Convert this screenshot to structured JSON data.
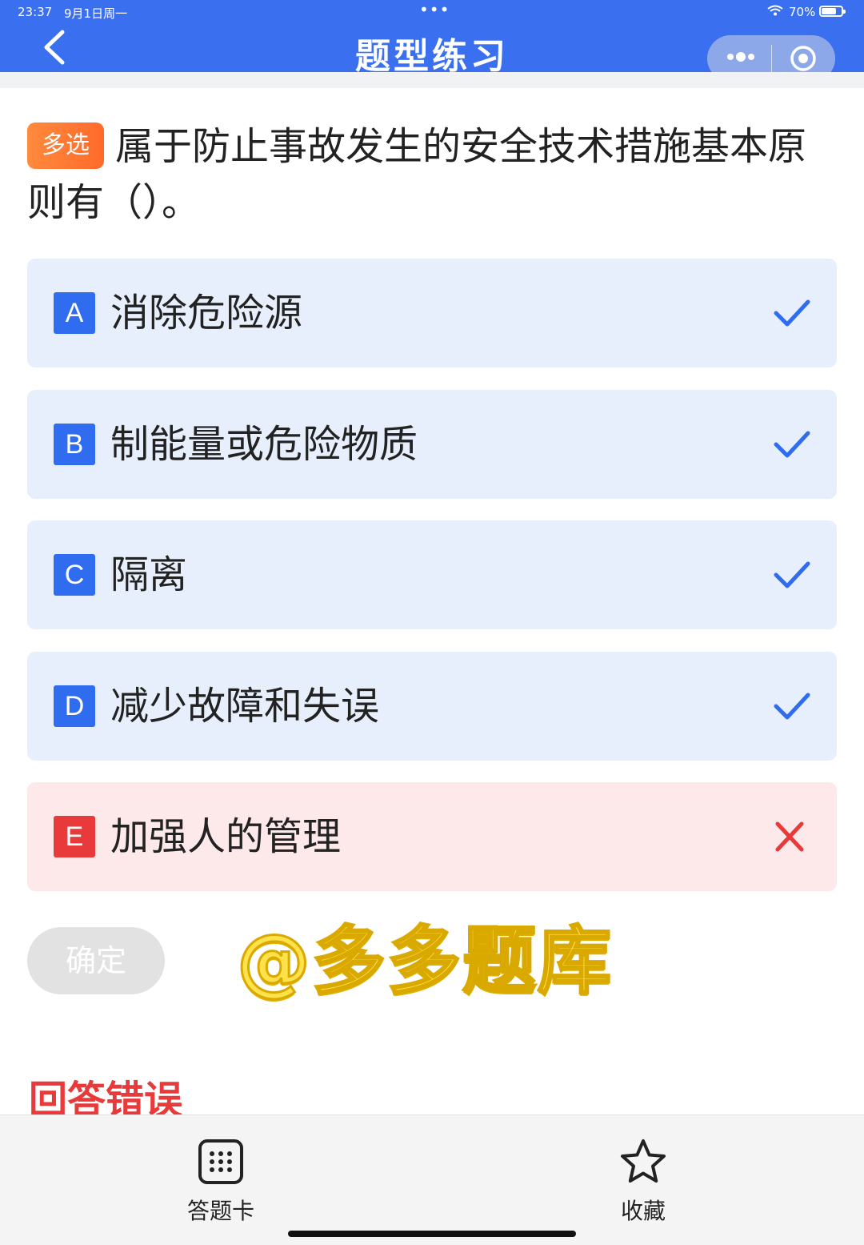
{
  "status_bar": {
    "time": "23:37",
    "date": "9月1日周一",
    "center_dots": "•••",
    "battery_percent": "70%",
    "battery_level": 0.7
  },
  "navbar": {
    "title": "题型练习",
    "back_icon": "chevron-left-icon",
    "capsule_icons": [
      "more-dots-icon",
      "target-icon"
    ]
  },
  "question": {
    "type_tag": "多选",
    "text": "属于防止事故发生的安全技术措施基本原则有（）。"
  },
  "options": [
    {
      "letter": "A",
      "text": "消除危险源",
      "status": "correct"
    },
    {
      "letter": "B",
      "text": "制能量或危险物质",
      "status": "correct"
    },
    {
      "letter": "C",
      "text": "隔离",
      "status": "correct"
    },
    {
      "letter": "D",
      "text": "减少故障和失误",
      "status": "correct"
    },
    {
      "letter": "E",
      "text": "加强人的管理",
      "status": "wrong"
    }
  ],
  "confirm_button": "确定",
  "watermark": "@多多题库",
  "result_text": "回答错误",
  "bottom_tabs": [
    {
      "label": "答题卡",
      "icon": "grid-icon"
    },
    {
      "label": "收藏",
      "icon": "star-icon"
    }
  ],
  "colors": {
    "primary": "#3a6ff0",
    "correct": "#2f6cf0",
    "wrong": "#e83a3a",
    "tag": "#ff6a2b"
  }
}
